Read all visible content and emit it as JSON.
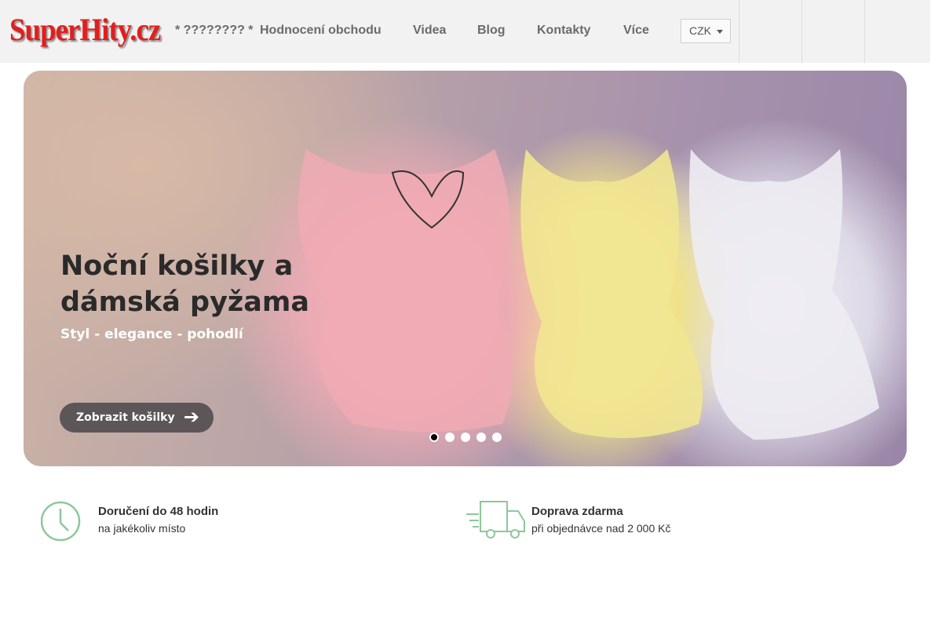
{
  "header": {
    "logo": "SuperHity.cz",
    "nav": [
      {
        "label": "* ???????? *"
      },
      {
        "label": "Hodnocení obchodu"
      },
      {
        "label": "Videa"
      },
      {
        "label": "Blog"
      },
      {
        "label": "Kontakty"
      },
      {
        "label": "Více",
        "caret": ""
      }
    ],
    "currency": "CZK",
    "buttons": [
      {
        "icon": "search-icon",
        "glyph": ""
      },
      {
        "icon": "user-icon",
        "glyph": ""
      },
      {
        "icon": "cart-icon",
        "glyph": ""
      }
    ]
  },
  "slider": {
    "title_line1": "Noční košilky a",
    "title_line2": "dámská pyžama",
    "subtitle": "Styl - elegance - pohodlí",
    "cta": "Zobrazit košilky",
    "cta_arrow": "➔",
    "prev": "",
    "next": "",
    "dots": 5,
    "active_dot": 1
  },
  "features": [
    {
      "icon": "clock-icon",
      "title": "Doručení do 48 hodin",
      "subtitle": "na jakékoliv místo"
    },
    {
      "icon": "truck-icon",
      "title": "Doprava zdarma",
      "subtitle": "při objednávce nad 2 000 Kč"
    }
  ],
  "colors": {
    "brand": "#e21e1e",
    "icon_green": "#8ec79b",
    "nav_text": "#6b6b6b"
  }
}
